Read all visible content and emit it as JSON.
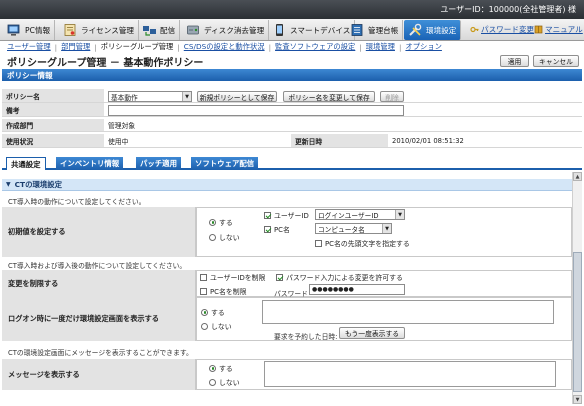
{
  "topbar": {
    "user_text": "ユーザーID：100000(全社管理者) 様"
  },
  "nav": {
    "tabs": [
      {
        "label": "PC情報",
        "icon": "pc-icon"
      },
      {
        "label": "ライセンス管理",
        "icon": "license-icon"
      },
      {
        "label": "配信",
        "icon": "distribution-icon"
      },
      {
        "label": "ディスク消去管理",
        "icon": "disk-erase-icon"
      },
      {
        "label": "スマートデバイス",
        "icon": "smart-device-icon"
      },
      {
        "label": "管理台帳",
        "icon": "ledger-icon"
      },
      {
        "label": "環境設定",
        "icon": "tools-icon",
        "active": true
      }
    ],
    "links": {
      "password": "パスワード変更",
      "manual": "マニュアル"
    }
  },
  "submenu": [
    {
      "label": "ユーザー管理"
    },
    {
      "label": "部門管理"
    },
    {
      "label": "ポリシーグループ管理",
      "current": true
    },
    {
      "label": "CS/DSの設定と動作状況"
    },
    {
      "label": "監査ソフトウェアの設定"
    },
    {
      "label": "環境管理"
    },
    {
      "label": "オプション"
    }
  ],
  "page": {
    "title": "ポリシーグループ管理 － 基本動作ポリシー",
    "apply_label": "適用",
    "cancel_label": "キャンセル"
  },
  "policy_info": {
    "header": "ポリシー情報",
    "name_label": "ポリシー名",
    "name_value": "基本動作",
    "save_new_label": "新規ポリシーとして保存",
    "rename_label": "ポリシー名を変更して保存",
    "delete_label": "削除",
    "note_label": "備考",
    "note_value": "",
    "dept_label": "作成部門",
    "dept_value": "管理対象",
    "status_label": "使用状況",
    "status_value": "使用中",
    "updated_label": "更新日時",
    "updated_value": "2010/02/01 08:51:32"
  },
  "tabs": [
    {
      "label": "共通設定",
      "active": true
    },
    {
      "label": "インベントリ情報"
    },
    {
      "label": "パッチ適用"
    },
    {
      "label": "ソフトウェア配信"
    }
  ],
  "ct_env": {
    "section_title": "CTの環境設定",
    "note_install": "CT導入時の動作について設定してください。",
    "initial_label": "初期値を設定する",
    "yes": "する",
    "no": "しない",
    "userid_cb": "ユーザーID",
    "userid_select": "ログインユーザーID",
    "pcname_cb": "PC名",
    "pcname_select": "コンピュータ名",
    "prefix_cb": "PC名の先頭文字を指定する",
    "note_after": "CT導入時および導入後の動作について設定してください。",
    "restrict_label": "変更を制限する",
    "restrict_userid": "ユーザーIDを制限",
    "allow_pw_change": "パスワード入力による変更を許可する",
    "restrict_pcname": "PC名を制限",
    "password_label": "パスワード",
    "password_value": "●●●●●●●●",
    "logon_label": "ログオン時に一度だけ環境設定画面を表示する",
    "request_date_label": "要求を予約した日時:",
    "show_again_label": "もう一度表示する",
    "note_message": "CTの環境設定画面にメッセージを表示することができます。",
    "message_label": "メッセージを表示する"
  }
}
